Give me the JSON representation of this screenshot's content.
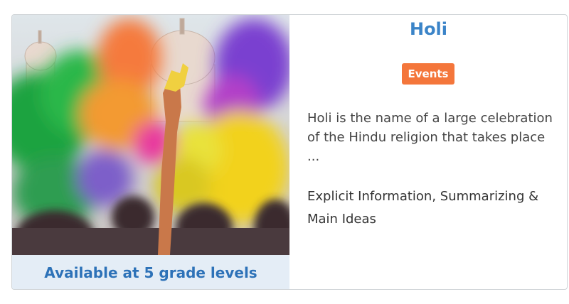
{
  "card": {
    "title": "Holi",
    "badge": "Events",
    "description": "Holi is the name of a large celebration of the Hindu religion that takes place ...",
    "skills": "Explicit Information, Summarizing & Main Ideas",
    "grade_levels": "Available at 5 grade levels",
    "image_subject": "holi-festival-color-powder-photo"
  },
  "colors": {
    "title": "#3b84c8",
    "badge_bg": "#f4763b",
    "grade_bar_bg": "#e4edf6",
    "grade_text": "#2d72b8"
  }
}
